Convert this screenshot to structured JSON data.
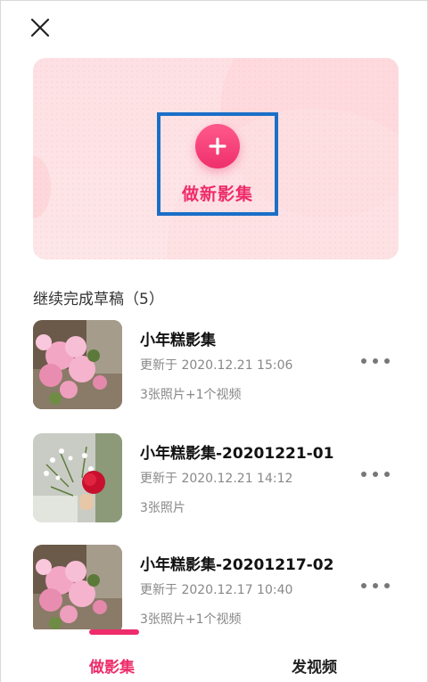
{
  "header": {
    "close_icon": "close-icon"
  },
  "hero": {
    "new_label": "做新影集",
    "accent": "#ee2c6b",
    "highlight_border": "#1b6fc7"
  },
  "drafts": {
    "title": "继续完成草稿（5）",
    "items": [
      {
        "title": "小年糕影集",
        "updated": "更新于 2020.12.21 15:06",
        "meta": "3张照片+1个视频",
        "thumb": "pink-blossom-photo"
      },
      {
        "title": "小年糕影集-20201221-01",
        "updated": "更新于 2020.12.21 14:12",
        "meta": "3张照片",
        "thumb": "red-rose-photo"
      },
      {
        "title": "小年糕影集-20201217-02",
        "updated": "更新于 2020.12.17 10:40",
        "meta": "3张照片+1个视频",
        "thumb": "pink-blossom-photo"
      }
    ]
  },
  "tabs": [
    {
      "label": "做影集",
      "active": true
    },
    {
      "label": "发视频",
      "active": false
    }
  ]
}
